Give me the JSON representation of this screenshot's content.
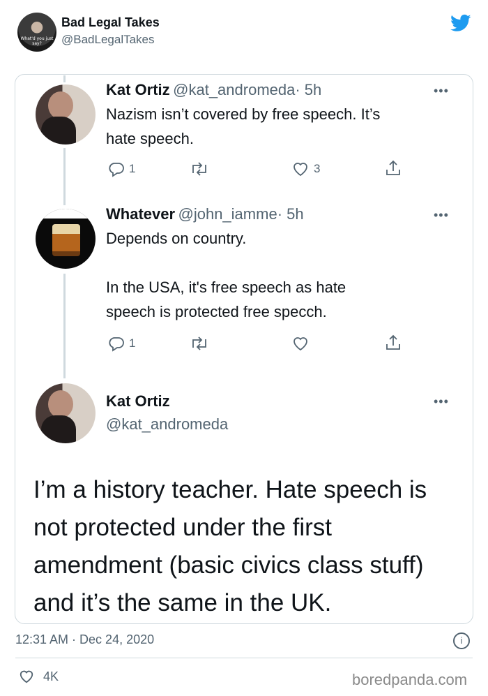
{
  "author": {
    "name": "Bad Legal Takes",
    "handle": "@BadLegalTakes",
    "avatar_caption": "What'd you just say?"
  },
  "quoted_thread": [
    {
      "name": "Kat Ortiz",
      "handle": "@kat_andromeda",
      "time": "· 5h",
      "text": "Nazism isn’t covered by free speech. It’s\nhate speech.",
      "replies": "1",
      "likes": "3"
    },
    {
      "name": "Whatever",
      "handle": "@john_iamme",
      "time": "· 5h",
      "text": "Depends on country.\n\nIn the USA, it's free speech as hate\nspeech is protected free specch.",
      "replies": "1",
      "likes": ""
    }
  ],
  "main_tweet": {
    "name": "Kat Ortiz",
    "handle": "@kat_andromeda",
    "text": "I’m a history teacher. Hate speech is\nnot protected under the first\namendment (basic civics class stuff)\nand it’s the same in the UK."
  },
  "footer": {
    "timestamp": "12:31 AM · Dec 24, 2020",
    "info_glyph": "i",
    "likes": "4K",
    "watermark": "boredpanda.com"
  },
  "icons": {
    "more": "•••",
    "brand_color": "#1d9bf0",
    "muted_color": "#536471"
  }
}
